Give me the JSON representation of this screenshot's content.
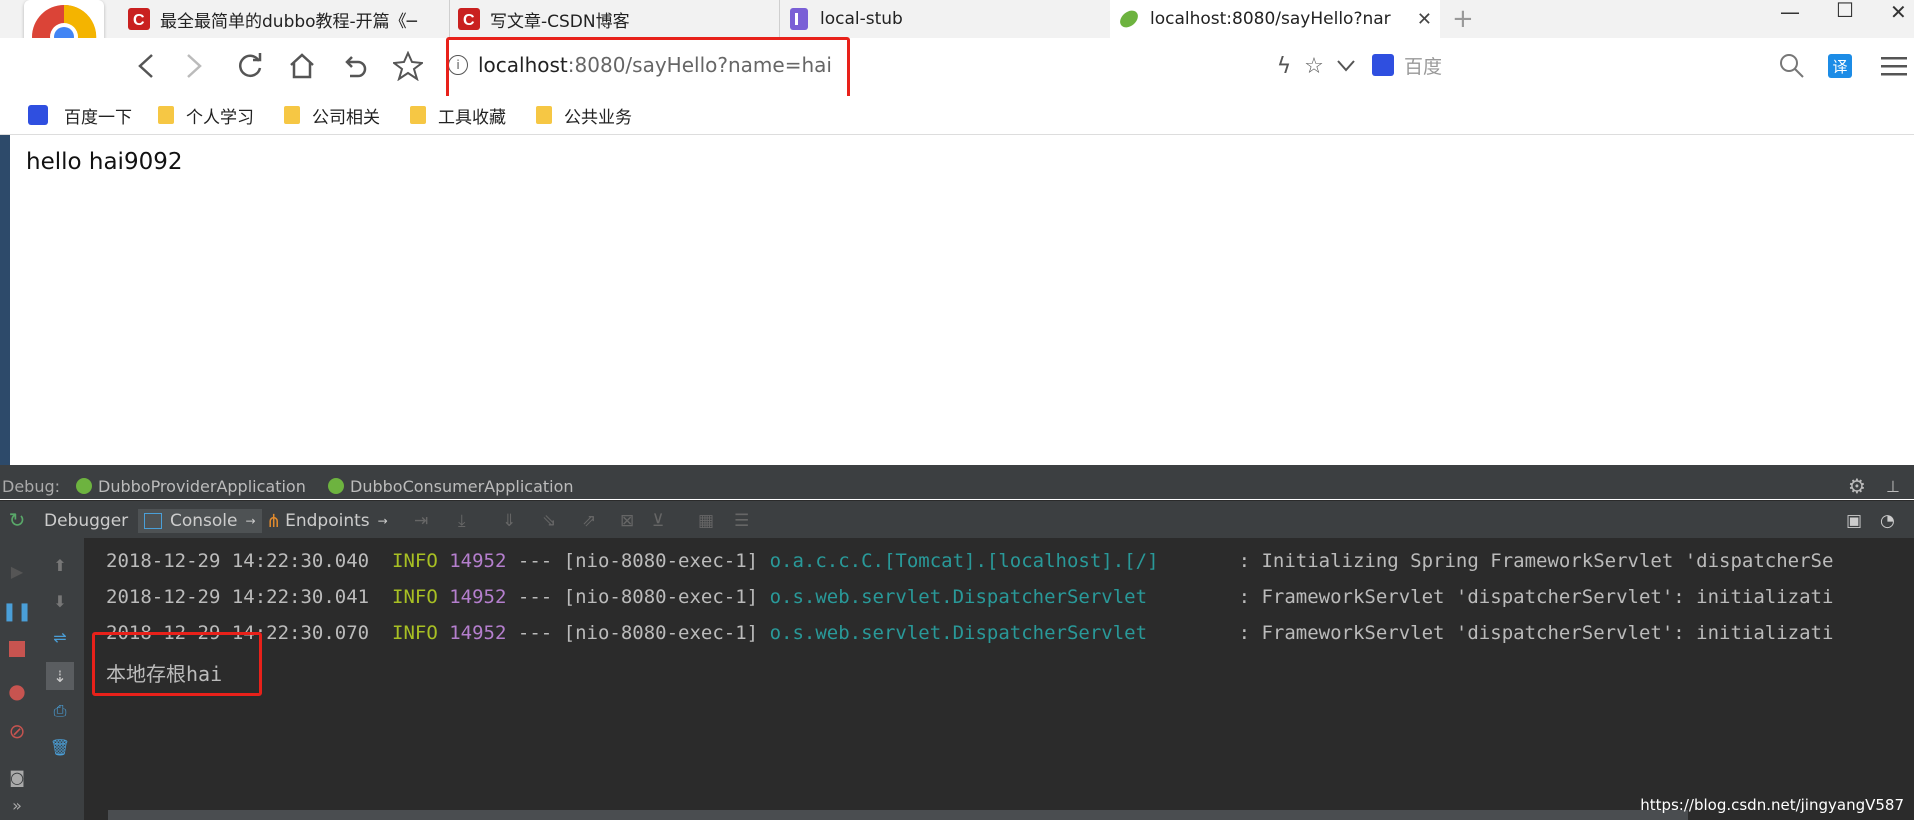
{
  "browser": {
    "tabs": [
      {
        "title": "最全最简单的dubbo教程-开篇《─",
        "favicon": "csdn-icon"
      },
      {
        "title": "写文章-CSDN博客",
        "favicon": "csdn-icon"
      },
      {
        "title": "local-stub",
        "favicon": "page-icon"
      },
      {
        "title": "localhost:8080/sayHello?nar",
        "favicon": "spring-leaf-icon",
        "active": true
      }
    ],
    "new_tab": "+",
    "address": {
      "host": "localhost",
      "rest": ":8080/sayHello?name=hai"
    },
    "search": {
      "placeholder": "百度",
      "translate_label": "译"
    },
    "bookmarks": [
      "百度一下",
      "个人学习",
      "公司相关",
      "工具收藏",
      "公共业务"
    ],
    "page_text": "hello hai9092"
  },
  "ide": {
    "debug_label": "Debug:",
    "run_configs": [
      "DubboProviderApplication",
      "DubboConsumerApplication"
    ],
    "tool_tabs": [
      "Debugger",
      "Console",
      "Endpoints"
    ],
    "log_lines": [
      {
        "ts": "2018-12-29 14:22:30.040",
        "level": "INFO",
        "pid": "14952",
        "sep": "---",
        "thread": "[nio-8080-exec-1]",
        "logger": "o.a.c.c.C.[Tomcat].[localhost].[/]      ",
        "msg": ": Initializing Spring FrameworkServlet 'dispatcherSe"
      },
      {
        "ts": "2018-12-29 14:22:30.041",
        "level": "INFO",
        "pid": "14952",
        "sep": "---",
        "thread": "[nio-8080-exec-1]",
        "logger": "o.s.web.servlet.DispatcherServlet       ",
        "msg": ": FrameworkServlet 'dispatcherServlet': initializati"
      },
      {
        "ts": "2018-12-29 14:22:30.070",
        "level": "INFO",
        "pid": "14952",
        "sep": "---",
        "thread": "[nio-8080-exec-1]",
        "logger": "o.s.web.servlet.DispatcherServlet       ",
        "msg": ": FrameworkServlet 'dispatcherServlet': initializati"
      }
    ],
    "output_line": "本地存根hai"
  },
  "watermark": "https://blog.csdn.net/jingyangV587",
  "colors": {
    "highlight_red": "#e8211a",
    "ide_bg": "#2b2b2b",
    "ide_panel": "#3c3f41"
  }
}
